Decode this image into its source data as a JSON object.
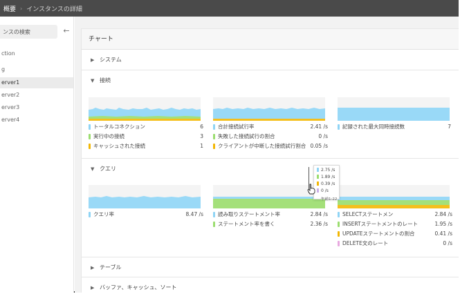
{
  "breadcrumb": {
    "overview": "概要",
    "separator": "›",
    "detail": "インスタンスの詳細"
  },
  "sidebar": {
    "search_text": "ンスの検索",
    "back_icon": "arrow-left-icon",
    "items": [
      {
        "label": "ction"
      },
      {
        "label": "g"
      },
      {
        "label": "erver1",
        "active": true
      },
      {
        "label": "erver2"
      },
      {
        "label": "erver3"
      },
      {
        "label": "erver4"
      }
    ]
  },
  "panel": {
    "title": "チャート"
  },
  "sections": {
    "system": {
      "label": "システム",
      "expanded": false
    },
    "connections": {
      "label": "接続",
      "expanded": true
    },
    "queries": {
      "label": "クエリ",
      "expanded": true
    },
    "tables": {
      "label": "テーブル",
      "expanded": false
    },
    "buffers": {
      "label": "バッファ、キャッシュ、ソート",
      "expanded": false
    }
  },
  "colors": {
    "blue": "#99d9f7",
    "green": "#a4e07a",
    "yellow": "#f5bf1d",
    "pink": "#e8a9e0",
    "purple": "#cbb0e8"
  },
  "connection_charts": [
    {
      "legend": [
        {
          "label": "トータルコネクション",
          "value": "6",
          "color": "#8fd4f5"
        },
        {
          "label": "実行中の接続",
          "value": "3",
          "color": "#9bdd6f"
        },
        {
          "label": "キャッシュされた接続",
          "value": "1",
          "color": "#f2b705"
        }
      ]
    },
    {
      "legend": [
        {
          "label": "合計接続試行率",
          "value": "2.41 /s",
          "color": "#8fd4f5"
        },
        {
          "label": "失敗した接続試行の割合",
          "value": "0 /s",
          "color": "#9bdd6f"
        },
        {
          "label": "クライアントが中断した接続試行割合",
          "value": "0.05 /s",
          "color": "#f2b705"
        }
      ]
    },
    {
      "legend": [
        {
          "label": "記録された最大同時接続数",
          "value": "7",
          "color": "#8fd4f5"
        }
      ]
    }
  ],
  "query_charts": [
    {
      "legend": [
        {
          "label": "クエリ率",
          "value": "8.47 /s",
          "color": "#8fd4f5"
        }
      ]
    },
    {
      "legend": [
        {
          "label": "読み取りステートメント率",
          "value": "2.84 /s",
          "color": "#8fd4f5"
        },
        {
          "label": "ステートメント率を書く",
          "value": "2.36 /s",
          "color": "#9bdd6f"
        }
      ]
    },
    {
      "legend": [
        {
          "label": "SELECTステートメン",
          "value": "2.84 /s",
          "color": "#8fd4f5"
        },
        {
          "label": "INSERTステートメントのレート",
          "value": "1.95 /s",
          "color": "#9bdd6f"
        },
        {
          "label": "UPDATEステートメントの割合",
          "value": "0.41 /s",
          "color": "#f2b705"
        },
        {
          "label": "DELETE文のレート",
          "value": "0 /s",
          "color": "#e8a9e0"
        }
      ]
    }
  ],
  "tooltip": {
    "rows": [
      {
        "value": "2.75 /s",
        "color": "#8fd4f5"
      },
      {
        "value": "1.89 /s",
        "color": "#9bdd6f"
      },
      {
        "value": "0.39 /s",
        "color": "#f2b705"
      },
      {
        "value": "0 /s",
        "color": "#cbb0e8"
      }
    ],
    "time": "午前1:22"
  }
}
